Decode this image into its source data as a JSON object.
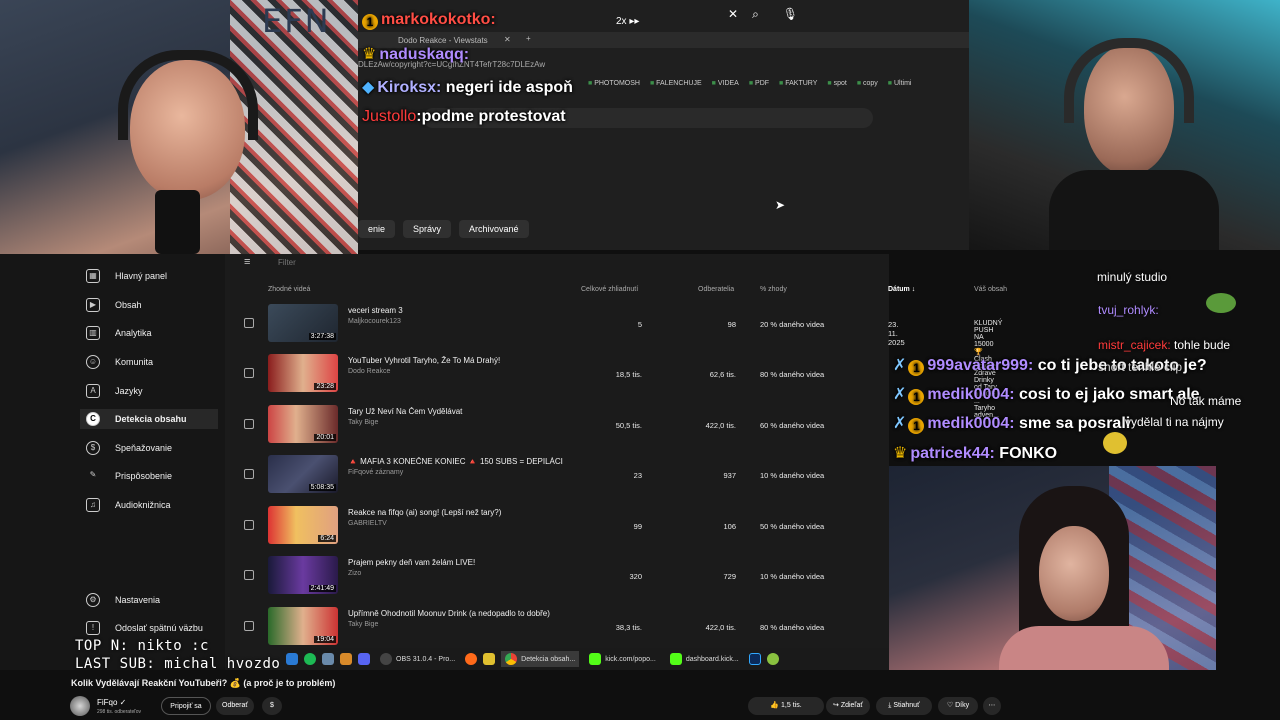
{
  "browser": {
    "tab_title": "Dodo Reakce - Viewstats",
    "url": "DLEzAw/copyright?c=UCgfhZNT4TefrT28c7DLEzAw",
    "speed": "2x",
    "bookmarks": [
      "PHOTOMOSH",
      "FALENCHUJE",
      "VIDEA",
      "PDF",
      "FAKTURY",
      "spot",
      "copy",
      "Ultimi"
    ],
    "studio_tabs": [
      "enie",
      "Správy",
      "Archivované"
    ]
  },
  "chat_overlay": [
    {
      "name": "markokokotko:",
      "text": ""
    },
    {
      "name": "naduskaqq:",
      "text": ""
    },
    {
      "name": "Kiroksx:",
      "text": "negeri ide aspoň"
    },
    {
      "name": "Justollo",
      "text": "podme protestovat"
    }
  ],
  "sidebar": {
    "items": [
      {
        "label": "Hlavný panel",
        "icon": "dashboard-icon"
      },
      {
        "label": "Obsah",
        "icon": "content-icon"
      },
      {
        "label": "Analytika",
        "icon": "analytics-icon"
      },
      {
        "label": "Komunita",
        "icon": "community-icon"
      },
      {
        "label": "Jazyky",
        "icon": "languages-icon"
      },
      {
        "label": "Detekcia obsahu",
        "icon": "copyright-icon"
      },
      {
        "label": "Speňažovanie",
        "icon": "monetization-icon"
      },
      {
        "label": "Prispôsobenie",
        "icon": "customization-icon"
      },
      {
        "label": "Audioknižnica",
        "icon": "audio-library-icon"
      }
    ],
    "settings": "Nastavenia",
    "feedback": "Odoslať spätnú väzbu"
  },
  "table": {
    "filter_placeholder": "Filter",
    "headers": {
      "video": "Zhodné videá",
      "views": "Celkové zhliadnutí",
      "subs": "Odberatelia",
      "match": "% zhody",
      "date": "Dátum",
      "yours": "Váš obsah"
    },
    "rows": [
      {
        "title": "veceri stream 3",
        "channel": "Maljkocourek123",
        "duration": "3:27:38",
        "views": "5",
        "subs": "98",
        "match": "20 % daného videa",
        "date": "23. 11. 2025",
        "yours": "KLUDNÝ PUSH NA 15000 🏆 Clash Royale"
      },
      {
        "title": "YouTuber Vyhrotil Taryho, Že To Má Drahý!",
        "channel": "Dodo Reakce",
        "duration": "23:28",
        "views": "18,5 tis.",
        "subs": "62,6 tis.",
        "match": "80 % daného videa",
        "date": "",
        "yours": "Zdravé Drinky od Tary a MGF ... Taryho adven..."
      },
      {
        "title": "Tary Už Neví Na Čem Vydělávat",
        "channel": "Taky Bige",
        "duration": "20:01",
        "views": "50,5 tis.",
        "subs": "422,0 tis.",
        "match": "60 % daného videa",
        "date": "",
        "yours": ""
      },
      {
        "title": "🔺 MAFIA 3 KONEČNE KONIEC 🔺 150 SUBS = DEPILÁCIA...",
        "channel": "FiFqové záznamy",
        "duration": "5:08:35",
        "views": "23",
        "subs": "937",
        "match": "10 % daného videa",
        "date": "",
        "yours": ""
      },
      {
        "title": "Reakce na fifqo (ai) song! (Lepší než tary?)",
        "channel": "GABRIELTV",
        "duration": "6:24",
        "views": "99",
        "subs": "106",
        "match": "50 % daného videa",
        "date": "",
        "yours": ""
      },
      {
        "title": "Prajem pekny deň vam želám LIVE!",
        "channel": "Zizo",
        "duration": "2:41:49",
        "views": "320",
        "subs": "729",
        "match": "10 % daného videa",
        "date": "",
        "yours": ""
      },
      {
        "title": "Upřímně Ohodnotil Moonuv Drink (a nedopadlo to dobře)",
        "channel": "Taky Bige",
        "duration": "19:04",
        "views": "38,3 tis.",
        "subs": "422,0 tis.",
        "match": "80 % daného videa",
        "date": "",
        "yours": ""
      }
    ]
  },
  "right_chat": [
    {
      "name": "",
      "text": "nulý studio"
    },
    {
      "name": "tvuj_rohlyk:",
      "text": ""
    },
    {
      "name": "mistr_cajicek:",
      "text": "tohle bude"
    },
    {
      "name": "999avatar999:",
      "text": "co ti jebe to takoto je?"
    },
    {
      "name": "",
      "text": "short tenhle clip"
    },
    {
      "name": "medik0004:",
      "text": "cosi to ej jako smart ale"
    },
    {
      "name": "",
      "text": "No tak máme"
    },
    {
      "name": "medik0004:",
      "text": "sme sa posrali"
    },
    {
      "name": "",
      "text": "vydělal ti na nájmy"
    },
    {
      "name": "patricek44:",
      "text": "FONKO"
    }
  ],
  "stream_overlay": {
    "top": "TOP N: nikto :c",
    "last_sub": "LAST SUB: michal_hvozdovic"
  },
  "taskbar": {
    "apps": [
      "OBS 31.0.4 - Pro...",
      "Detekcia obsah...",
      "kick.com/popo...",
      "dashboard.kick..."
    ]
  },
  "youtube": {
    "title": "Kolik Vydělávají Reakční YouTubeři? 💰 (a proč je to problém)",
    "channel": "FiFqo",
    "subs": "298 tis. odberateľov",
    "join": "Pripojiť sa",
    "subscribe": "Odberať",
    "likes": "1,5 tis.",
    "share": "Zdieľať",
    "download": "Stiahnuť",
    "thanks": "Díky"
  },
  "colors": {
    "accent_red": "#ff4e45",
    "chat_purple": "#b08cff",
    "mod_red": "#ff3b3b"
  }
}
